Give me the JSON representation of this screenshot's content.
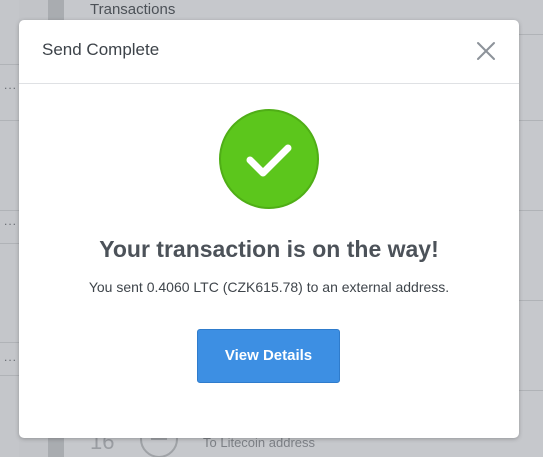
{
  "background": {
    "title": "Transactions",
    "row_date": "16",
    "row_text": "To Litecoin address",
    "row_menu": "..."
  },
  "modal": {
    "title": "Send Complete",
    "close_icon": "close-icon",
    "status_icon": "checkmark-circle-icon",
    "headline": "Your transaction is on the way!",
    "message": "You sent 0.4060 LTC (CZK615.78) to an external address.",
    "view_details_label": "View Details"
  },
  "colors": {
    "success_green": "#5cc61c",
    "button_blue": "#3d8fe3",
    "title_text": "#3d4349"
  }
}
